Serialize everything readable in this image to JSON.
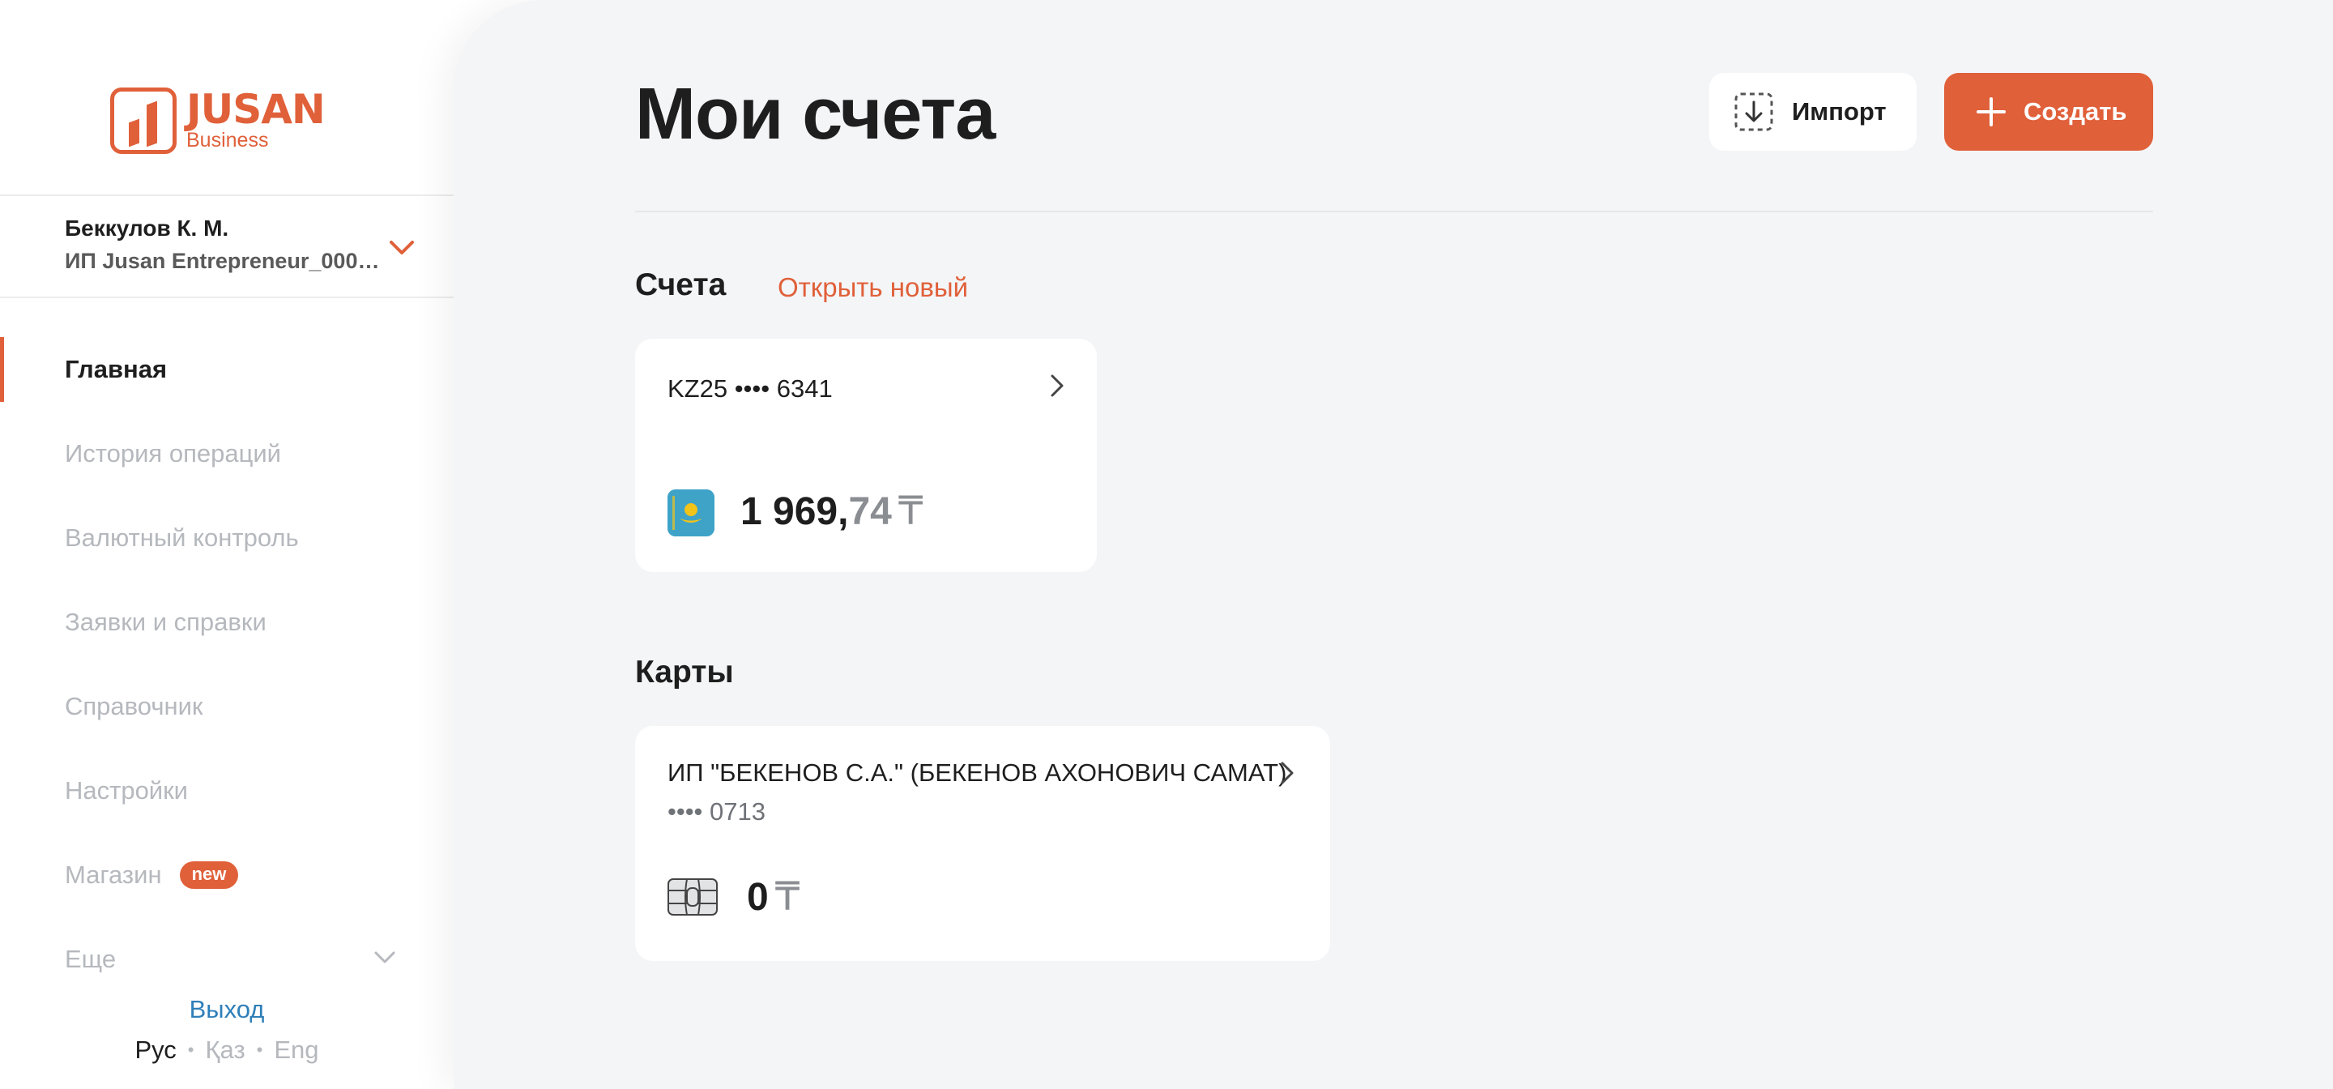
{
  "brand": {
    "name": "JUSAN",
    "sub": "Business"
  },
  "user": {
    "name": "Беккулов К. М.",
    "company": "ИП Jusan Entrepreneur_0009..."
  },
  "nav": {
    "items": [
      {
        "label": "Главная"
      },
      {
        "label": "История операций"
      },
      {
        "label": "Валютный контроль"
      },
      {
        "label": "Заявки и справки"
      },
      {
        "label": "Справочник"
      },
      {
        "label": "Настройки"
      },
      {
        "label": "Магазин",
        "badge": "new"
      },
      {
        "label": "Еще"
      }
    ]
  },
  "footer": {
    "logout": "Выход",
    "languages": [
      "Рус",
      "Қаз",
      "Eng"
    ],
    "language_separator": "•",
    "active_language": "Рус"
  },
  "page": {
    "title": "Мои счета"
  },
  "buttons": {
    "import": "Импорт",
    "create": "Создать"
  },
  "accounts": {
    "title": "Счета",
    "open_new": "Открыть новый",
    "items": [
      {
        "number": "KZ25 •••• 6341",
        "amount_int": "1 969,",
        "amount_dec": "74",
        "currency": "₸"
      }
    ]
  },
  "cards": {
    "title": "Карты",
    "items": [
      {
        "holder": "ИП \"БЕКЕНОВ С.А.\" (БЕКЕНОВ АХОНОВИЧ САМАТ)",
        "number": "•••• 0713",
        "amount": "0",
        "currency": "₸"
      }
    ]
  },
  "colors": {
    "accent": "#e0603a",
    "link": "#2f7fb9",
    "background": "#f4f5f7",
    "text": "#1e1e1e",
    "muted": "#b5b8bd"
  }
}
